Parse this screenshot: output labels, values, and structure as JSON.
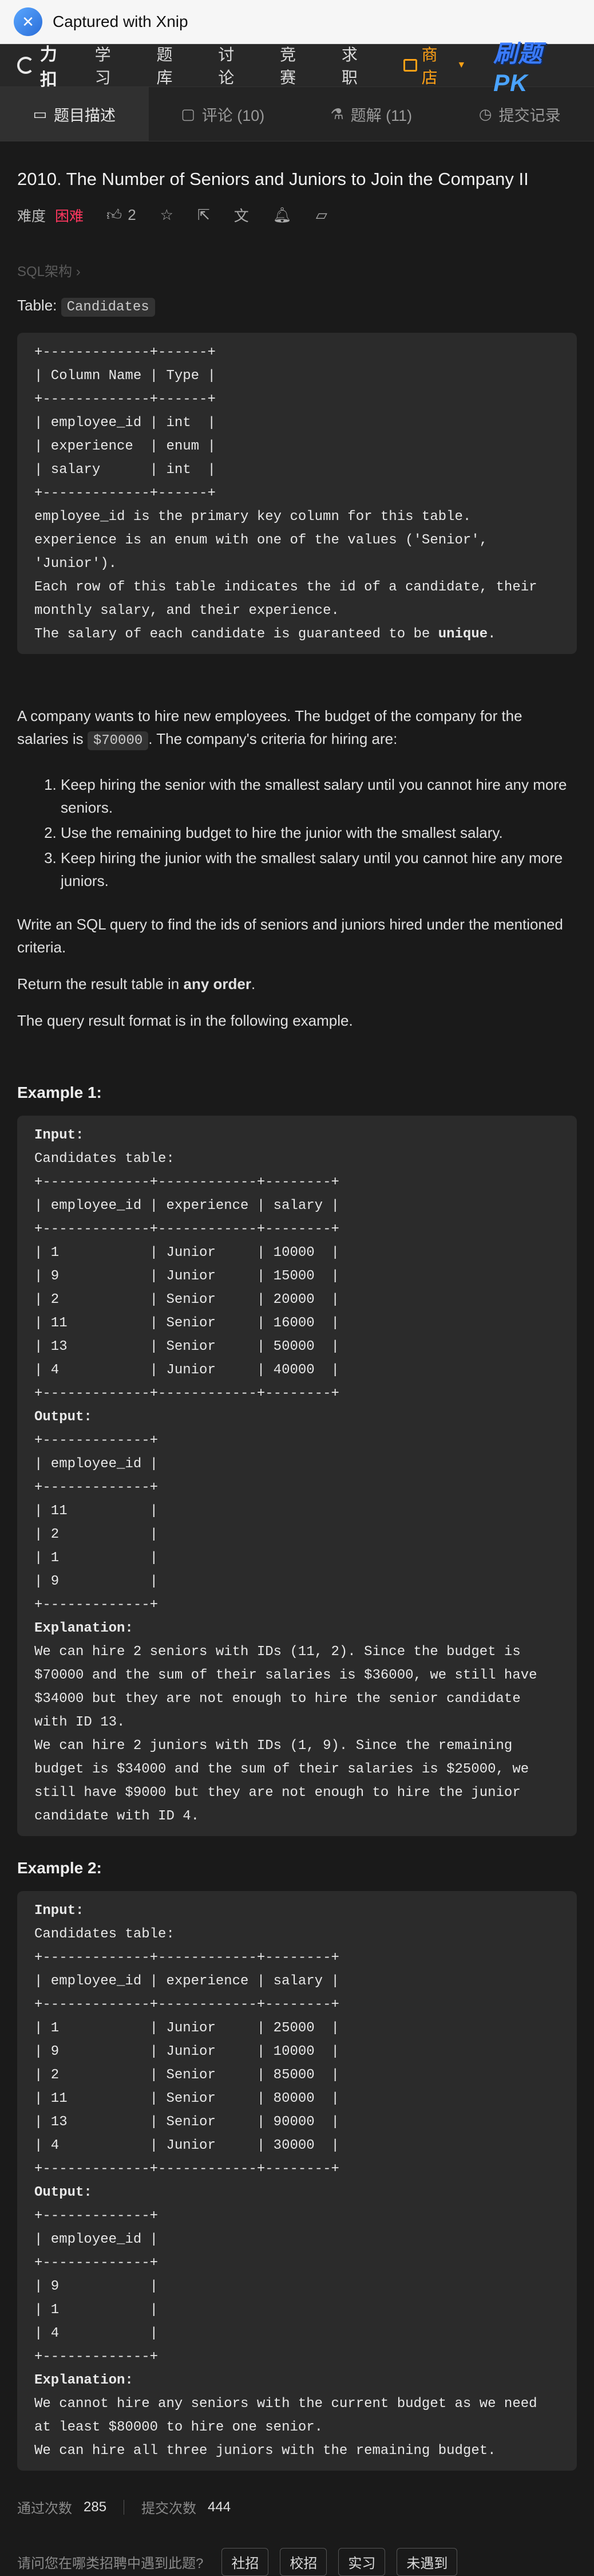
{
  "titlebar": {
    "text": "Captured with Xnip"
  },
  "nav": {
    "brand": "力扣",
    "items": [
      "学习",
      "题库",
      "讨论",
      "竞赛",
      "求职"
    ],
    "store": "商店",
    "pk_a": "刷题",
    "pk_b": "PK"
  },
  "tabs": [
    {
      "label": "题目描述",
      "icon": "description-icon"
    },
    {
      "label": "评论 (10)",
      "icon": "comment-icon"
    },
    {
      "label": "题解 (11)",
      "icon": "flask-icon"
    },
    {
      "label": "提交记录",
      "icon": "history-icon"
    }
  ],
  "problem": {
    "title": "2010. The Number of Seniors and Juniors to Join the Company II",
    "difficulty_label": "难度",
    "difficulty": "困难",
    "likes": "2",
    "section": "SQL架构 ›",
    "table_label": "Table:",
    "table_name": "Candidates",
    "schema_block": "+-------------+------+\n| Column Name | Type |\n+-------------+------+\n| employee_id | int  |\n| experience  | enum |\n| salary      | int  |\n+-------------+------+\nemployee_id is the primary key column for this table.\nexperience is an enum with one of the values ('Senior', 'Junior').\nEach row of this table indicates the id of a candidate, their monthly salary, and their experience.\nThe salary of each candidate is guaranteed to be ",
    "schema_bold": "unique",
    "schema_end": ".",
    "desc_1": "A company wants to hire new employees. The budget of the company for the salaries is ",
    "budget": "$70000",
    "desc_2": ". The company's criteria for hiring are:",
    "criteria": [
      "Keep hiring the senior with the smallest salary until you cannot hire any more seniors.",
      "Use the remaining budget to hire the junior with the smallest salary.",
      "Keep hiring the junior with the smallest salary until you cannot hire any more juniors."
    ],
    "query_text": "Write an SQL query to find the ids of seniors and juniors hired under the mentioned criteria.",
    "return_pre": "Return the result table in ",
    "return_bold": "any order",
    "return_post": ".",
    "format_text": "The query result format is in the following example."
  },
  "examples": [
    {
      "title": "Example 1:",
      "input_label": "Input:",
      "input_body": "Candidates table:\n+-------------+------------+--------+\n| employee_id | experience | salary |\n+-------------+------------+--------+\n| 1           | Junior     | 10000  |\n| 9           | Junior     | 15000  |\n| 2           | Senior     | 20000  |\n| 11          | Senior     | 16000  |\n| 13          | Senior     | 50000  |\n| 4           | Junior     | 40000  |\n+-------------+------------+--------+",
      "output_label": "Output:",
      "output_body": "+-------------+\n| employee_id |\n+-------------+\n| 11          |\n| 2           |\n| 1           |\n| 9           |\n+-------------+",
      "explanation_label": "Explanation:",
      "explanation_body": "We can hire 2 seniors with IDs (11, 2). Since the budget is $70000 and the sum of their salaries is $36000, we still have $34000 but they are not enough to hire the senior candidate with ID 13.\nWe can hire 2 juniors with IDs (1, 9). Since the remaining budget is $34000 and the sum of their salaries is $25000, we still have $9000 but they are not enough to hire the junior candidate with ID 4."
    },
    {
      "title": "Example 2:",
      "input_label": "Input:",
      "input_body": "Candidates table:\n+-------------+------------+--------+\n| employee_id | experience | salary |\n+-------------+------------+--------+\n| 1           | Junior     | 25000  |\n| 9           | Junior     | 10000  |\n| 2           | Senior     | 85000  |\n| 11          | Senior     | 80000  |\n| 13          | Senior     | 90000  |\n| 4           | Junior     | 30000  |\n+-------------+------------+--------+",
      "output_label": "Output:",
      "output_body": "+-------------+\n| employee_id |\n+-------------+\n| 9           |\n| 1           |\n| 4           |\n+-------------+",
      "explanation_label": "Explanation:",
      "explanation_body": "We cannot hire any seniors with the current budget as we need at least $80000 to hire one senior.\nWe can hire all three juniors with the remaining budget."
    }
  ],
  "stats": {
    "accepted_label": "通过次数",
    "accepted": "285",
    "submitted_label": "提交次数",
    "submitted": "444"
  },
  "survey": {
    "question": "请问您在哪类招聘中遇到此题?",
    "options": [
      "社招",
      "校招",
      "实习",
      "未遇到"
    ]
  }
}
